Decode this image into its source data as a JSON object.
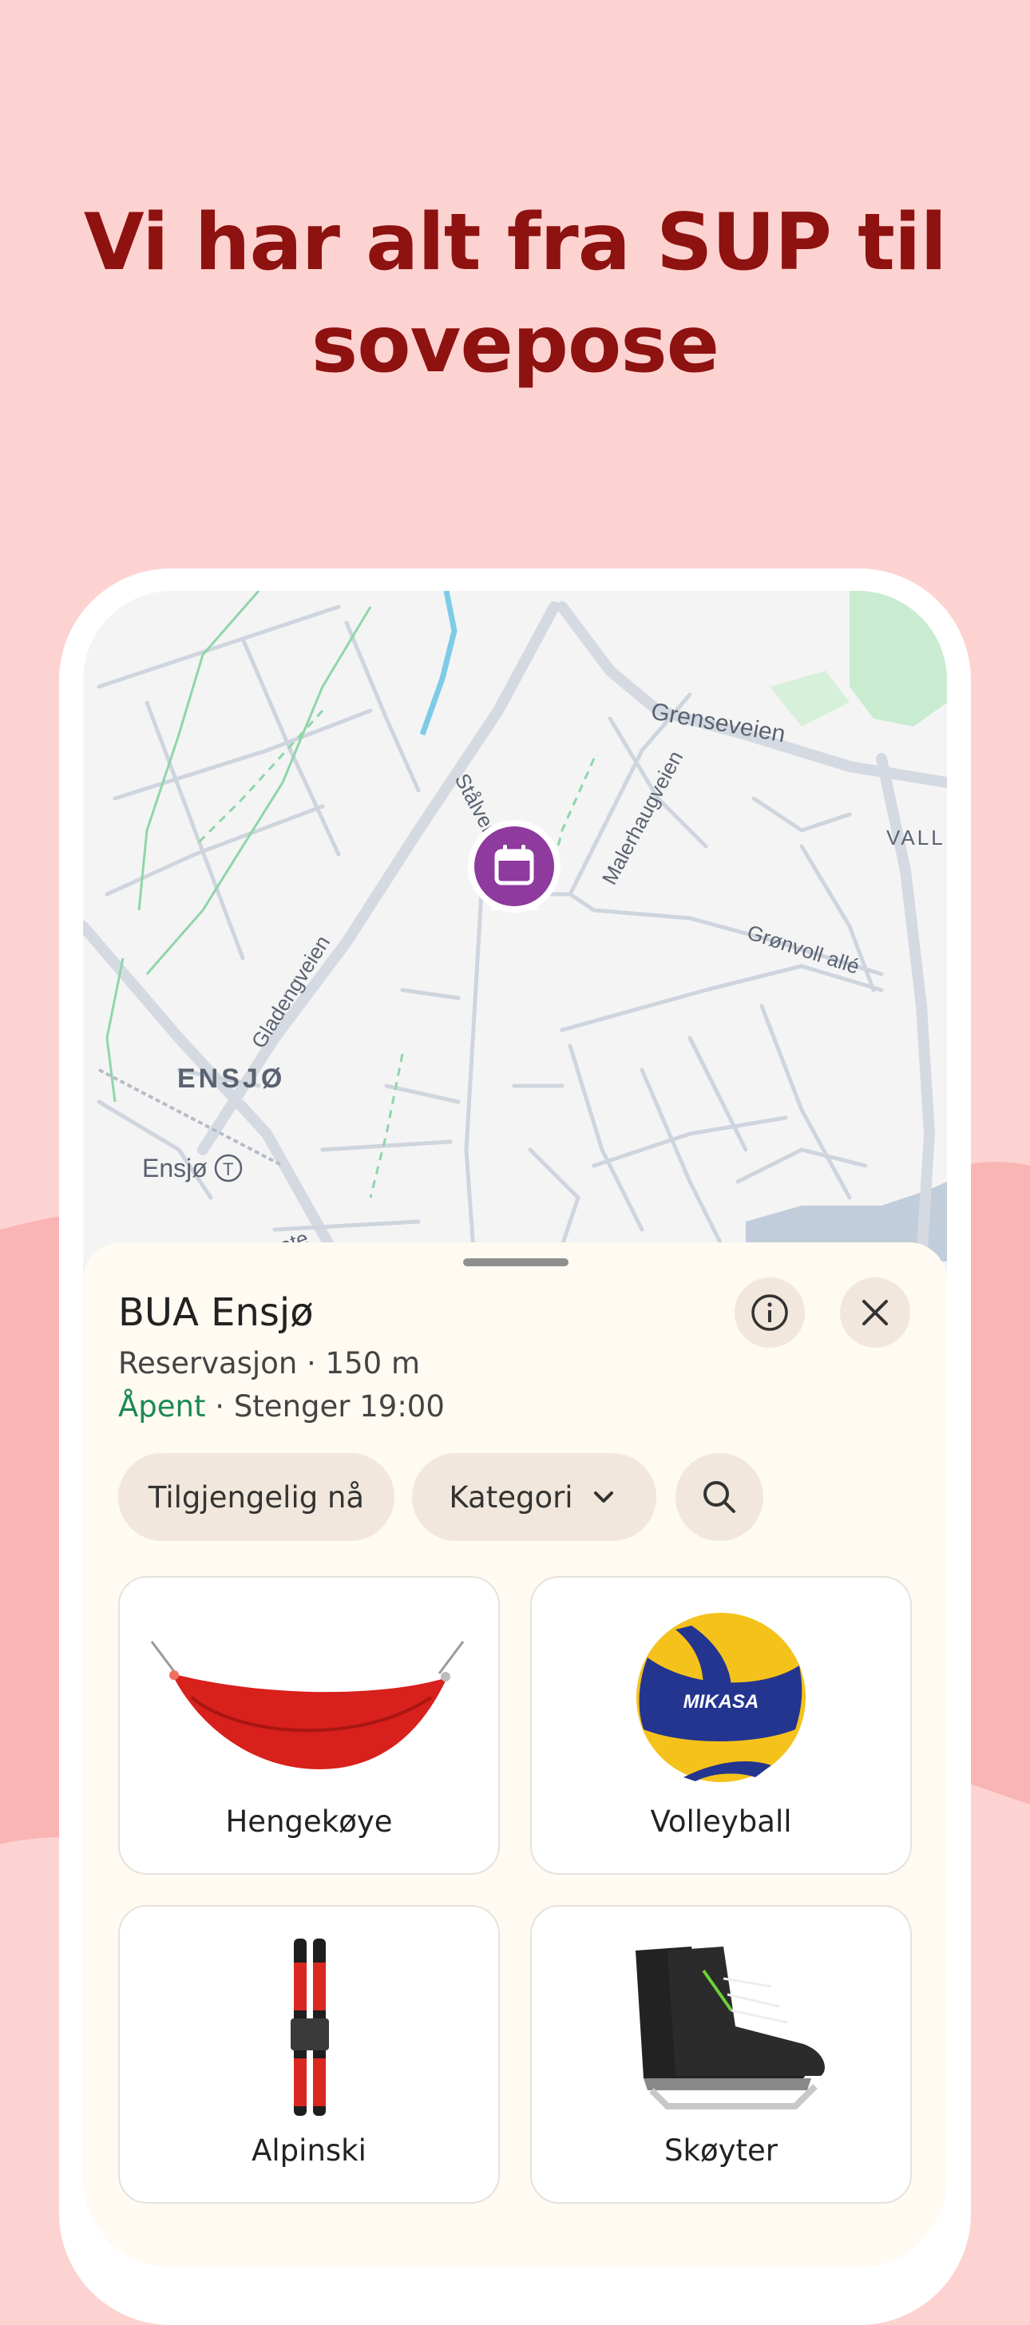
{
  "headline": {
    "line1": "Vi har alt fra SUP til",
    "line2": "sovepose"
  },
  "map": {
    "labels": {
      "grenseveien": "Grenseveien",
      "stalverksveien": "Stålverksveien",
      "malerhaugveien": "Malerhaugveien",
      "vall": "VALL",
      "gronvoll": "Grønvoll allé",
      "gladengveien": "Gladengveien",
      "ensjo_area": "ENSJØ",
      "ensjo_station": "Ensjø",
      "station_symbol": "T",
      "partial_road": "ate"
    },
    "pin_icon": "calendar-icon",
    "pin_color": "#8e3a9e"
  },
  "sheet": {
    "title": "BUA Ensjø",
    "subtitle": "Reservasjon · 150 m",
    "status_open": "Åpent",
    "status_rest": " · Stenger 19:00",
    "info_icon": "info-icon",
    "close_icon": "close-icon",
    "filters": {
      "available_now": "Tilgjengelig nå",
      "category": "Kategori",
      "category_icon": "chevron-down-icon",
      "search_icon": "search-icon"
    },
    "items": [
      {
        "label": "Hengekøye"
      },
      {
        "label": "Volleyball",
        "brand": "MIKASA"
      },
      {
        "label": "Alpinski"
      },
      {
        "label": "Skøyter"
      }
    ]
  },
  "colors": {
    "background": "#fdd3d1",
    "headline": "#8e1210",
    "open_status": "#1b8a55",
    "sheet_bg": "#fffaf2",
    "chip_bg": "#f1e7dc"
  }
}
